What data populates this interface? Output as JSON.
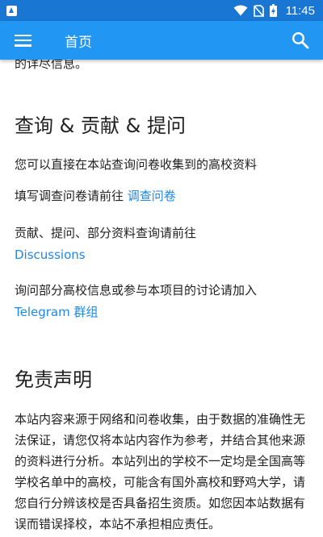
{
  "status_bar": {
    "time": "11:45",
    "icons": [
      "notification-a-icon",
      "wifi-icon",
      "no-sim-icon",
      "battery-charging-icon"
    ],
    "background": "#1976d2"
  },
  "app_bar": {
    "title": "首页",
    "menu_icon": "hamburger-menu-icon",
    "search_icon": "search-icon",
    "background": "#2196f3"
  },
  "content": {
    "cut_text": "的详尽信息。",
    "section_query": {
      "heading": "查询 & 贡献 & 提问",
      "p1": "您可以直接在本站查询问卷收集到的高校资料",
      "p2_text": "填写调查问卷请前往 ",
      "p2_link": "调查问卷",
      "p3_text": "贡献、提问、部分资料查询请前往",
      "p3_link": "Discussions",
      "p4_text": "询问部分高校信息或参与本项目的讨论请加入",
      "p4_link": "Telegram 群组"
    },
    "section_disclaimer": {
      "heading": "免责声明",
      "body": "本站内容来源于网络和问卷收集，由于数据的准确性无法保证，请您仅将本站内容作为参考，并结合其他来源的资料进行分析。本站列出的学校不一定均是全国高等学校名单中的高校，可能含有国外高校和野鸡大学，请您自行分辨该校是否具备招生资质。如您因本站数据有误而错误择校，本站不承担相应责任。"
    },
    "link_color": "#1e88e5"
  }
}
